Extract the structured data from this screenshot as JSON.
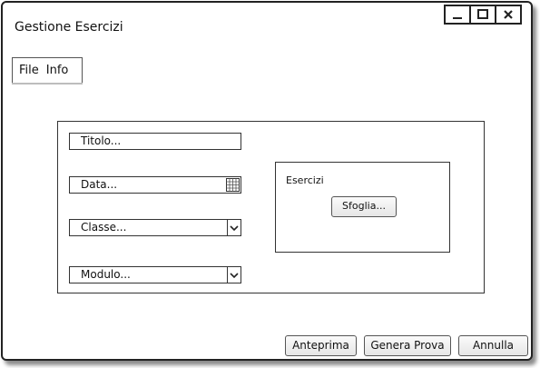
{
  "window": {
    "title": "Gestione Esercizi"
  },
  "menu": {
    "items": [
      "File",
      "Info"
    ]
  },
  "form": {
    "titolo_placeholder": "Titolo...",
    "data_placeholder": "Data...",
    "classe_placeholder": "Classe...",
    "modulo_placeholder": "Modulo..."
  },
  "esercizi": {
    "label": "Esercizi",
    "browse_label": "Sfoglia..."
  },
  "footer": {
    "preview_label": "Anteprima",
    "generate_label": "Genera Prova",
    "cancel_label": "Annulla"
  }
}
